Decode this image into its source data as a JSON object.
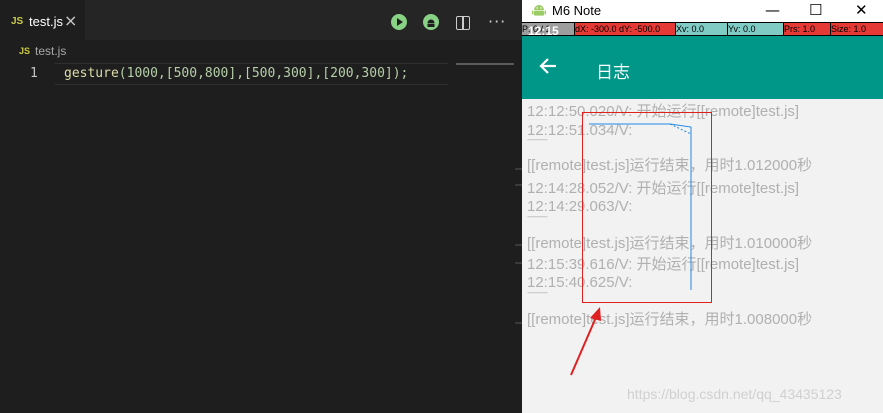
{
  "editor": {
    "tab": {
      "lang_badge": "JS",
      "filename": "test.js",
      "close": "×"
    },
    "breadcrumb": {
      "lang_badge": "JS",
      "filename": "test.js"
    },
    "code_lines": [
      {
        "number": "1",
        "fn": "gesture",
        "rest": "(1000,[500,800],[500,300],[200,300]);"
      }
    ],
    "more_menu": "···"
  },
  "emulator": {
    "window_title": "M6 Note",
    "window_controls": {
      "minimize": "—",
      "maximize": "☐",
      "close": "✕"
    },
    "pointer_bar": {
      "p": "P: 0 / 1",
      "dx": "dX: -300.0",
      "dy": "dY: -500.0",
      "xv": "Xv: 0.0",
      "yv": "Yv: 0.0",
      "prs": "Prs: 1.0",
      "size": "Size: 1.0"
    },
    "status_time": "12:15",
    "appbar_title": "日志",
    "log_lines": [
      "12:12:50.020/V: 开始运行[[remote]test.js]",
      "12:12:51.034/V:",
      "------------",
      "[[remote]test.js]运行结束，用时1.012000秒",
      "12:14:28.052/V: 开始运行[[remote]test.js]",
      "12:14:29.063/V:",
      "------------",
      "[[remote]test.js]运行结束，用时1.010000秒",
      "12:15:39.616/V: 开始运行[[remote]test.js]",
      "12:15:40.625/V:",
      "------------",
      "[[remote]test.js]运行结束，用时1.008000秒"
    ],
    "watermark": "https://blog.csdn.net/qq_43435123"
  },
  "colors": {
    "accent": "#009688",
    "highlight": "#e02020",
    "gesture_trace": "#1e88e5"
  }
}
